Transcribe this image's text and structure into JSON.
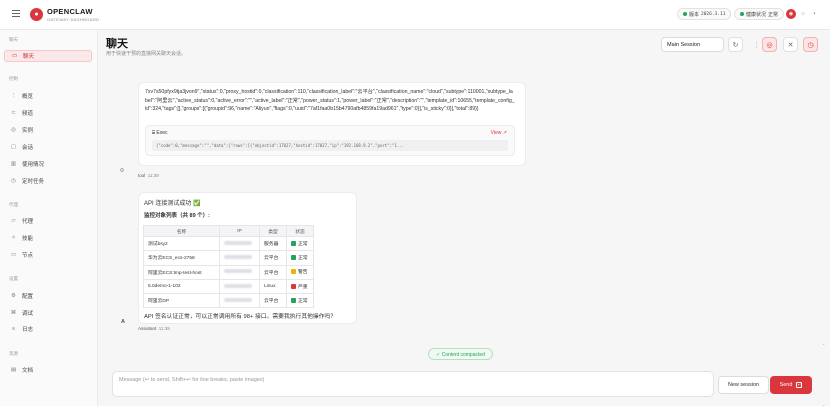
{
  "app": {
    "name": "OPENCLAW",
    "subtitle": "GATEWAY DASHBOARD"
  },
  "header": {
    "version_label": "版本",
    "version_value": "2026.3.11",
    "health_label": "健康状况",
    "health_value": "正常"
  },
  "sidebar": {
    "sections": [
      {
        "label": "聊天",
        "items": [
          {
            "label": "聊天",
            "icon": "chat-icon",
            "active": true
          }
        ]
      },
      {
        "label": "控制",
        "items": [
          {
            "label": "概览",
            "icon": "chart-icon"
          },
          {
            "label": "频道",
            "icon": "link-icon"
          },
          {
            "label": "实例",
            "icon": "radio-icon"
          },
          {
            "label": "会话",
            "icon": "file-icon"
          },
          {
            "label": "使用情况",
            "icon": "bar-chart-icon"
          },
          {
            "label": "定时任务",
            "icon": "clock-icon"
          }
        ]
      },
      {
        "label": "代理",
        "items": [
          {
            "label": "代理",
            "icon": "folder-icon"
          },
          {
            "label": "技能",
            "icon": "spark-icon"
          },
          {
            "label": "节点",
            "icon": "monitor-icon"
          }
        ]
      },
      {
        "label": "设置",
        "items": [
          {
            "label": "配置",
            "icon": "gear-icon"
          },
          {
            "label": "调试",
            "icon": "bug-icon"
          },
          {
            "label": "日志",
            "icon": "log-icon"
          }
        ]
      },
      {
        "label": "资源",
        "items": [
          {
            "label": "文档",
            "icon": "book-icon"
          }
        ]
      }
    ]
  },
  "page": {
    "title": "聊天",
    "subtitle": "用于快速干预的直接网关聊天会话。",
    "session": "Main Session"
  },
  "tool_message": {
    "json_text": "7xv7s50pfyx9tja3jvon9\",\"status\":0,\"proxy_hostid\":0,\"classification\":110,\"classification_label\":\"云平台\",\"classification_name\":\"cloud\",\"subtype\":110001,\"subtype_label\":\"阿里云\",\"active_status\":0,\"active_error\":\"\",\"active_label\":\"正常\",\"power_status\":1,\"power_label\":\"正常\",\"description\":\"\",\"template_id\":10655,\"template_config_id\":324,\"tags\":[],\"groups\":[{\"groupid\":96,\"name\":\"Aliyun\",\"flags\":0,\"uuid\":\"7af1faa0b15b4790afb4859fa19ad961\",\"type\":0}],\"is_sticky\":0}],\"total\":89}}",
    "exec_label": "Exec",
    "view_label": "View ↗",
    "code_text": "{\"code\":0,\"message\":\"\",\"data\":{\"rows\":[{\"objectid\":17027,\"hostid\":17027,\"ip\":\"192.168.9.2\",\"port\":\"1...",
    "sender": "tool",
    "time": "11:39"
  },
  "assistant_message": {
    "line1": "API 连接测试成功 ✅",
    "line2": "监控对象列表（共 89 个）:",
    "columns": [
      "名称",
      "IP",
      "类型",
      "状态"
    ],
    "rows": [
      {
        "name": "测试bsy2",
        "type": "服务器",
        "status": "正常",
        "status_color": "#22a55b"
      },
      {
        "name": "华为云ECS_ecs-2758",
        "type": "云平台",
        "status": "正常",
        "status_color": "#22a55b"
      },
      {
        "name": "阿里云ECS:tmp-test-host",
        "type": "云平台",
        "status": "警告",
        "status_color": "#f0b400"
      },
      {
        "name": "6.0demo-1-102",
        "type": "Linux",
        "status": "严重",
        "status_color": "#d9363e"
      },
      {
        "name": "阿里云DP",
        "type": "云平台",
        "status": "正常",
        "status_color": "#22a55b"
      }
    ],
    "footer": "API 签名认证正常，可以正常调用所有 98+ 接口。需要我执行其他操作吗？",
    "sender": "Assistant",
    "time": "11:39"
  },
  "compacted": "✓ Content compacted",
  "composer": {
    "placeholder": "Message (↩ to send, Shift+↩ for line breaks, paste images)",
    "new_session": "New session",
    "send": "Send"
  }
}
